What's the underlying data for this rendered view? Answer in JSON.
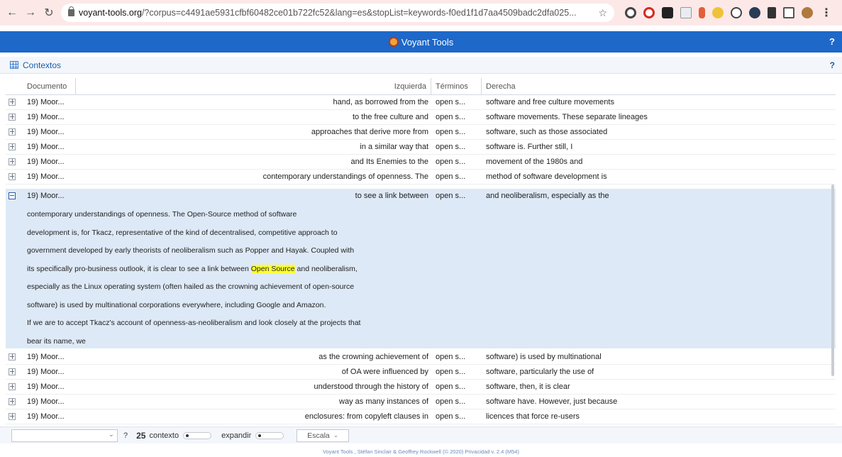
{
  "browser": {
    "url_domain": "voyant-tools.org",
    "url_rest": "/?corpus=c4491ae5931cfbf60482ce01b722fc52&lang=es&stopList=keywords-f0ed1f1d7aa4509badc2dfa025..."
  },
  "app": {
    "title": "Voyant Tools",
    "help": "?"
  },
  "panel": {
    "title": "Contextos",
    "help": "?"
  },
  "columns": {
    "document": "Documento",
    "left": "Izquierda",
    "term": "Términos",
    "right": "Derecha"
  },
  "rows_top": [
    {
      "doc": "19) Moor...",
      "left": "hand, as borrowed from the",
      "term": "open s...",
      "right": "software and free culture movements"
    },
    {
      "doc": "19) Moor...",
      "left": "to the free culture and",
      "term": "open s...",
      "right": "software movements. These separate lineages"
    },
    {
      "doc": "19) Moor...",
      "left": "approaches that derive more from",
      "term": "open s...",
      "right": "software, such as those associated"
    },
    {
      "doc": "19) Moor...",
      "left": "in a similar way that",
      "term": "open s...",
      "right": "software is. Further still, I"
    },
    {
      "doc": "19) Moor...",
      "left": "and Its Enemies to the",
      "term": "open s...",
      "right": "movement of the 1980s and"
    },
    {
      "doc": "19) Moor...",
      "left": "contemporary understandings of openness. The",
      "term": "open s...",
      "right": "method of software development is"
    }
  ],
  "expanded_row": {
    "doc": "19) Moor...",
    "left": "to see a link between",
    "term": "open s...",
    "right": "and neoliberalism, especially as the",
    "context": {
      "line1": "contemporary understandings of openness. The Open-Source method of software",
      "line2": "development is, for Tkacz, representative of the kind of decentralised, competitive approach to",
      "line3": "government developed by early theorists of neoliberalism such as Popper and Hayak. Coupled with",
      "line4_before": "its specifically pro-business outlook, it is clear to see a link between ",
      "line4_highlight": "Open Source",
      "line4_after": " and neoliberalism,",
      "line5": "especially as the Linux operating system (often hailed as the crowning achievement of open-source",
      "line6": "software) is used by multinational corporations everywhere, including Google and Amazon.",
      "line7": "If we are to accept Tkacz's account of openness-as-neoliberalism and look closely at the projects that",
      "line8": "bear its name, we"
    }
  },
  "rows_bottom": [
    {
      "doc": "19) Moor...",
      "left": "as the crowning achievement of",
      "term": "open s...",
      "right": "software) is used by multinational"
    },
    {
      "doc": "19) Moor...",
      "left": "of OA were influenced by",
      "term": "open s...",
      "right": "software, particularly the use of"
    },
    {
      "doc": "19) Moor...",
      "left": "understood through the history of",
      "term": "open s...",
      "right": "software, then, it is clear"
    },
    {
      "doc": "19) Moor...",
      "left": "way as many instances of",
      "term": "open s...",
      "right": "software have. However, just because"
    },
    {
      "doc": "19) Moor...",
      "left": "enclosures: from copyleft clauses in",
      "term": "open s...",
      "right": "licences that force re-users"
    }
  ],
  "toolbar": {
    "help": "?",
    "context_value": "25",
    "context_label": "contexto",
    "expand_label": "expandir",
    "scale_label": "Escala"
  },
  "footer": "Voyant Tools , Stéfan Sinclair & Geoffrey Rockwell (© 2020) Privacidad v. 2.4 (M54)",
  "colors": {
    "brand_blue": "#1d68c9",
    "highlight": "#ffff33",
    "expanded_bg": "#dde9f6"
  }
}
